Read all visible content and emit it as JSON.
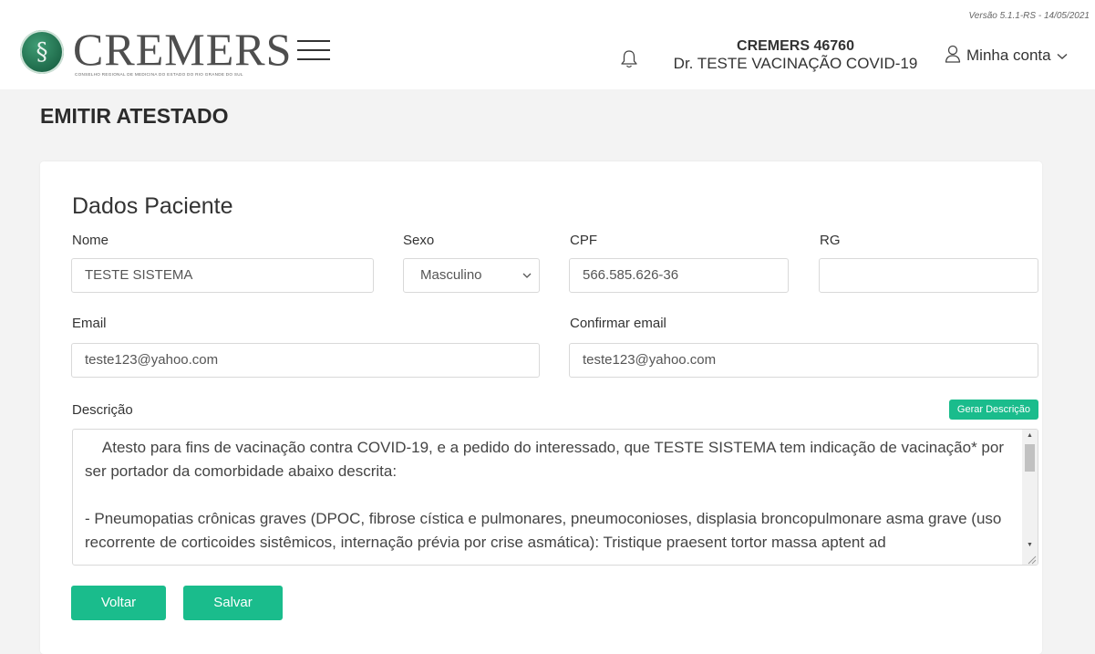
{
  "header": {
    "version": "Versão 5.1.1-RS - 14/05/2021",
    "logo_text": "CREMERS",
    "logo_subtitle": "CONSELHO REGIONAL DE MEDICINA DO ESTADO DO RIO GRANDE DO SUL",
    "user_code": "CREMERS 46760",
    "user_name": "Dr. TESTE VACINAÇÃO COVID-19",
    "account_label": "Minha conta"
  },
  "page": {
    "title": "EMITIR ATESTADO"
  },
  "form": {
    "section_title": "Dados Paciente",
    "nome": {
      "label": "Nome",
      "value": "TESTE SISTEMA"
    },
    "sexo": {
      "label": "Sexo",
      "value": "Masculino"
    },
    "cpf": {
      "label": "CPF",
      "value": "566.585.626-36"
    },
    "rg": {
      "label": "RG",
      "value": ""
    },
    "email": {
      "label": "Email",
      "value": "teste123@yahoo.com"
    },
    "confirm_email": {
      "label": "Confirmar email",
      "value": "teste123@yahoo.com"
    },
    "descricao": {
      "label": "Descrição",
      "generate_label": "Gerar Descrição",
      "value": "    Atesto para fins de vacinação contra COVID-19, e a pedido do interessado, que TESTE SISTEMA tem indicação de vacinação* por ser portador da comorbidade abaixo descrita:\n\n- Pneumopatias crônicas graves (DPOC, fibrose cística e pulmonares, pneumoconioses, displasia broncopulmonare asma grave (uso recorrente de corticoides sistêmicos, internação prévia por crise asmática): Tristique praesent tortor massa aptent ad"
    },
    "buttons": {
      "back": "Voltar",
      "save": "Salvar"
    }
  },
  "colors": {
    "accent": "#1abc8c",
    "background": "#f3f3f3"
  },
  "icons": {
    "logo": "caduceus-emblem-icon",
    "menu": "hamburger-menu-icon",
    "notifications": "bell-icon",
    "account": "user-icon",
    "account_toggle": "chevron-down-icon"
  }
}
